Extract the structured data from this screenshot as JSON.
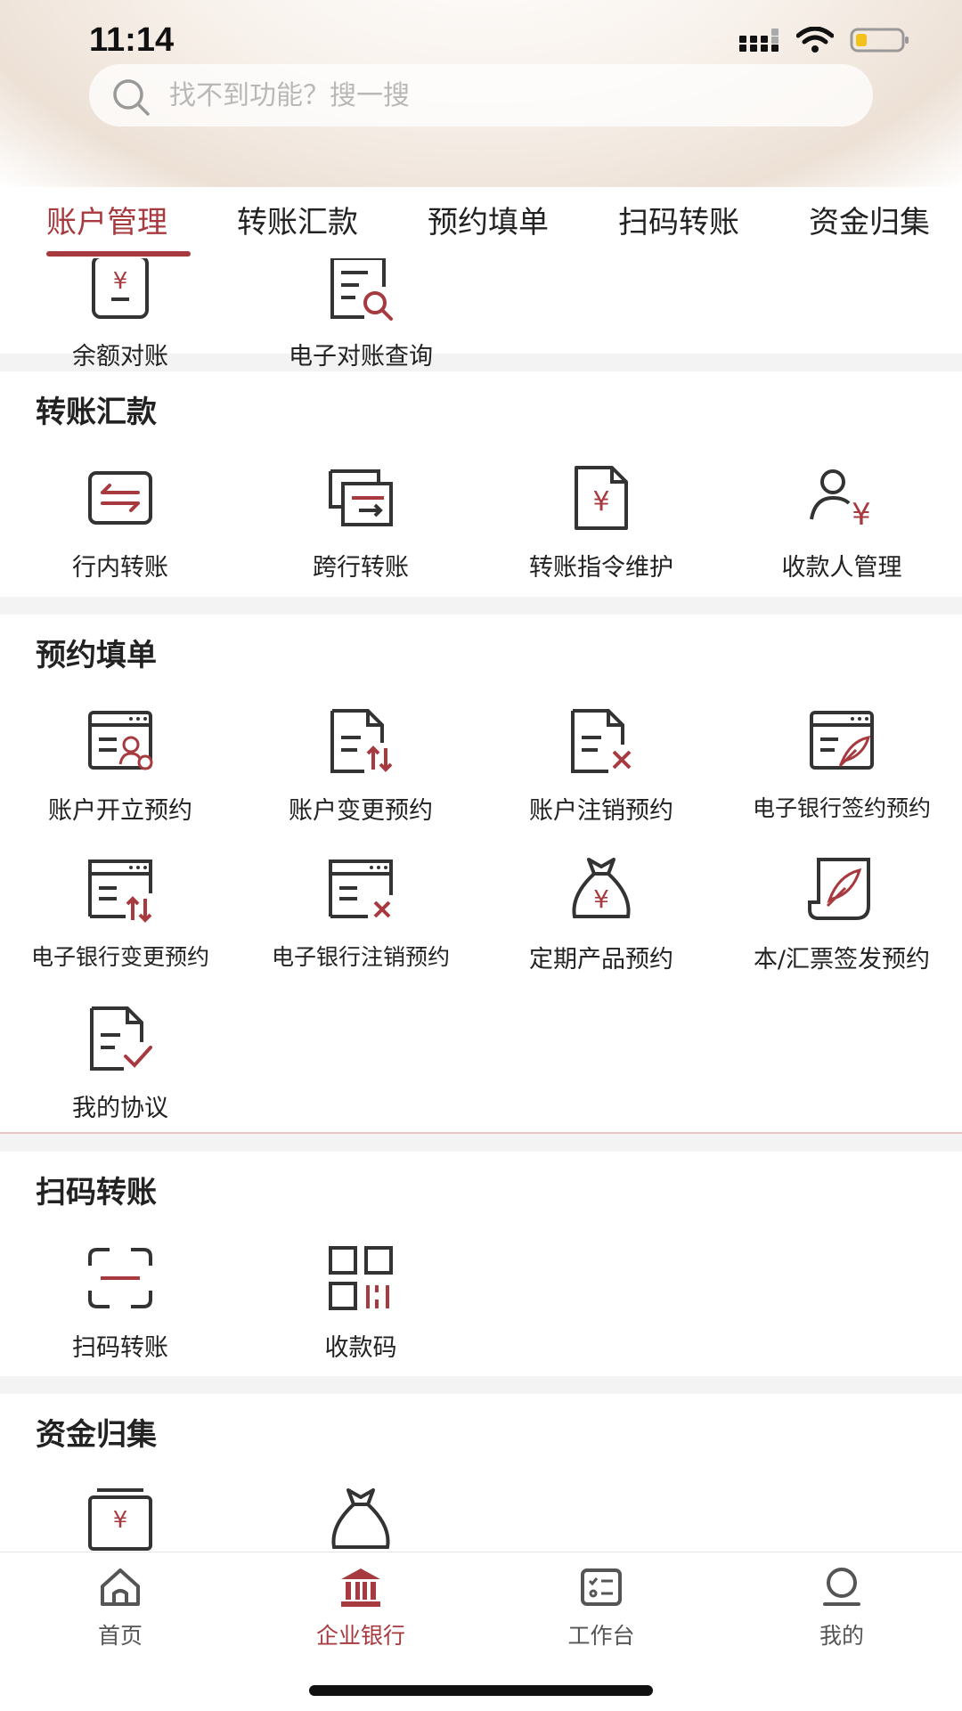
{
  "status_bar": {
    "time": "11:14"
  },
  "search": {
    "placeholder": "找不到功能？搜一搜"
  },
  "tabs": [
    {
      "label": "账户管理",
      "active": true
    },
    {
      "label": "转账汇款",
      "active": false
    },
    {
      "label": "预约填单",
      "active": false
    },
    {
      "label": "扫码转账",
      "active": false
    },
    {
      "label": "资金归集",
      "active": false
    }
  ],
  "account_items": [
    {
      "label": "余额对账",
      "icon": "yuan-doc-icon"
    },
    {
      "label": "电子对账查询",
      "icon": "doc-search-icon"
    }
  ],
  "transfer": {
    "title": "转账汇款",
    "items": [
      {
        "label": "行内转账",
        "icon": "swap-arrows-icon"
      },
      {
        "label": "跨行转账",
        "icon": "cross-bank-icon"
      },
      {
        "label": "转账指令维护",
        "icon": "yuan-file-icon"
      },
      {
        "label": "收款人管理",
        "icon": "payee-icon"
      }
    ]
  },
  "booking": {
    "title": "预约填单",
    "items": [
      {
        "label": "账户开立预约",
        "icon": "account-open-icon"
      },
      {
        "label": "账户变更预约",
        "icon": "account-change-icon"
      },
      {
        "label": "账户注销预约",
        "icon": "account-cancel-icon"
      },
      {
        "label": "电子银行签约预约",
        "icon": "ebank-sign-icon"
      },
      {
        "label": "电子银行变更预约",
        "icon": "ebank-change-icon"
      },
      {
        "label": "电子银行注销预约",
        "icon": "ebank-cancel-icon"
      },
      {
        "label": "定期产品预约",
        "icon": "money-bag-icon"
      },
      {
        "label": "本/汇票签发预约",
        "icon": "draft-sign-icon"
      },
      {
        "label": "我的协议",
        "icon": "agreement-icon"
      }
    ]
  },
  "scan": {
    "title": "扫码转账",
    "items": [
      {
        "label": "扫码转账",
        "icon": "scan-icon"
      },
      {
        "label": "收款码",
        "icon": "qr-code-icon"
      }
    ]
  },
  "funds": {
    "title": "资金归集"
  },
  "bottom_nav": [
    {
      "label": "首页",
      "icon": "home-icon",
      "active": false
    },
    {
      "label": "企业银行",
      "icon": "bank-icon",
      "active": true
    },
    {
      "label": "工作台",
      "icon": "workbench-icon",
      "active": false
    },
    {
      "label": "我的",
      "icon": "profile-icon",
      "active": false
    }
  ],
  "colors": {
    "accent": "#a63a3f",
    "icon_dark": "#333333",
    "section_gap": "#f3f3f3"
  }
}
